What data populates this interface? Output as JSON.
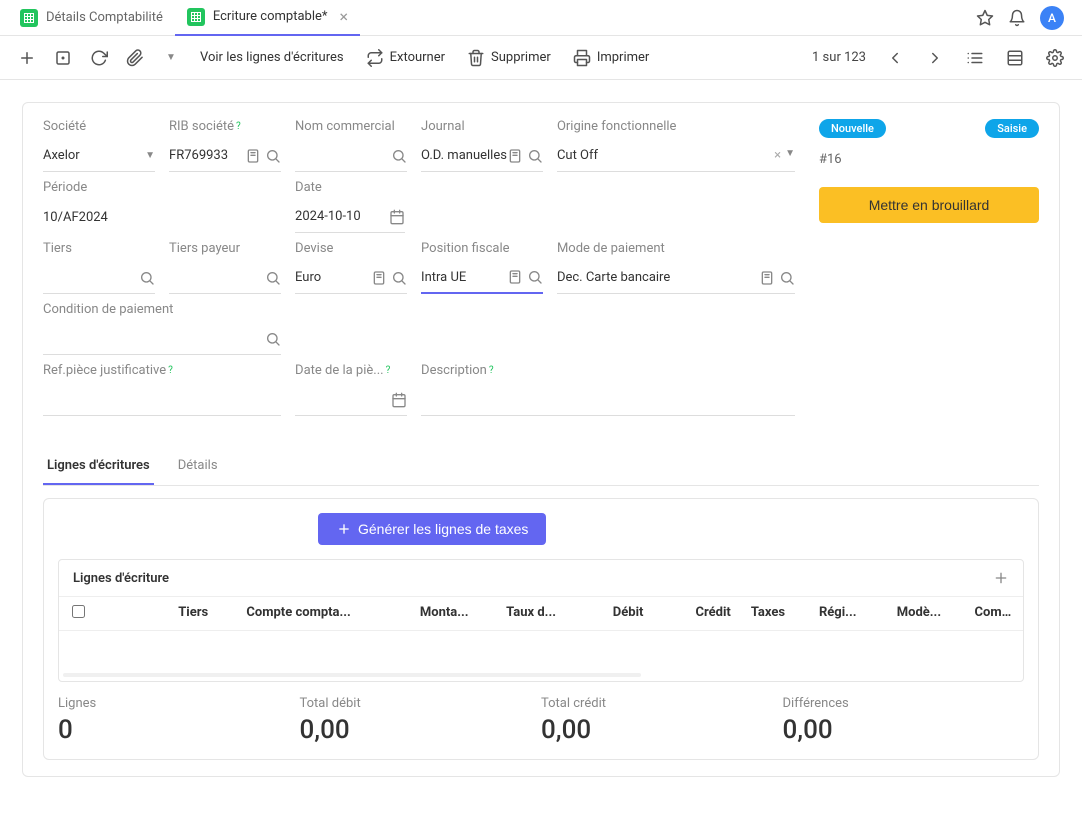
{
  "tabs": [
    {
      "label": "Détails Comptabilité",
      "active": false
    },
    {
      "label": "Ecriture comptable*",
      "active": true
    }
  ],
  "avatar_letter": "A",
  "toolbar": {
    "view_lines": "Voir les lignes d'écritures",
    "reverse": "Extourner",
    "delete": "Supprimer",
    "print": "Imprimer",
    "pager": "1 sur 123"
  },
  "fields": {
    "company": {
      "label": "Société",
      "value": "Axelor"
    },
    "rib": {
      "label": "RIB société",
      "value": "FR769933"
    },
    "commercial_name": {
      "label": "Nom commercial",
      "value": ""
    },
    "journal": {
      "label": "Journal",
      "value": "O.D. manuelles"
    },
    "origin": {
      "label": "Origine fonctionnelle",
      "value": "Cut Off"
    },
    "period": {
      "label": "Période",
      "value": "10/AF2024"
    },
    "date": {
      "label": "Date",
      "value": "2024-10-10"
    },
    "partner": {
      "label": "Tiers",
      "value": ""
    },
    "payer": {
      "label": "Tiers payeur",
      "value": ""
    },
    "currency": {
      "label": "Devise",
      "value": "Euro"
    },
    "fiscal_pos": {
      "label": "Position fiscale",
      "value": "Intra UE"
    },
    "payment_mode": {
      "label": "Mode de paiement",
      "value": "Dec. Carte bancaire"
    },
    "payment_cond": {
      "label": "Condition de paiement",
      "value": ""
    },
    "ref_doc": {
      "label": "Ref.pièce justificative",
      "value": ""
    },
    "doc_date": {
      "label": "Date de la piè...",
      "value": ""
    },
    "description": {
      "label": "Description",
      "value": ""
    }
  },
  "status": {
    "badge_new": "Nouvelle",
    "badge_entry": "Saisie",
    "ref": "#16",
    "draft_btn": "Mettre en brouillard"
  },
  "subtabs": {
    "lines": "Lignes d'écritures",
    "details": "Détails"
  },
  "lines": {
    "generate_btn": "Générer les lignes de taxes",
    "panel_title": "Lignes d'écriture",
    "columns": {
      "tiers": "Tiers",
      "compte": "Compte compta...",
      "montant": "Monta...",
      "taux": "Taux d...",
      "debit": "Débit",
      "credit": "Crédit",
      "taxes": "Taxes",
      "regi": "Régi...",
      "mode": "Modè...",
      "comp": "Comp..."
    }
  },
  "totals": {
    "lines_label": "Lignes",
    "lines_value": "0",
    "debit_label": "Total débit",
    "debit_value": "0,00",
    "credit_label": "Total crédit",
    "credit_value": "0,00",
    "diff_label": "Différences",
    "diff_value": "0,00"
  }
}
